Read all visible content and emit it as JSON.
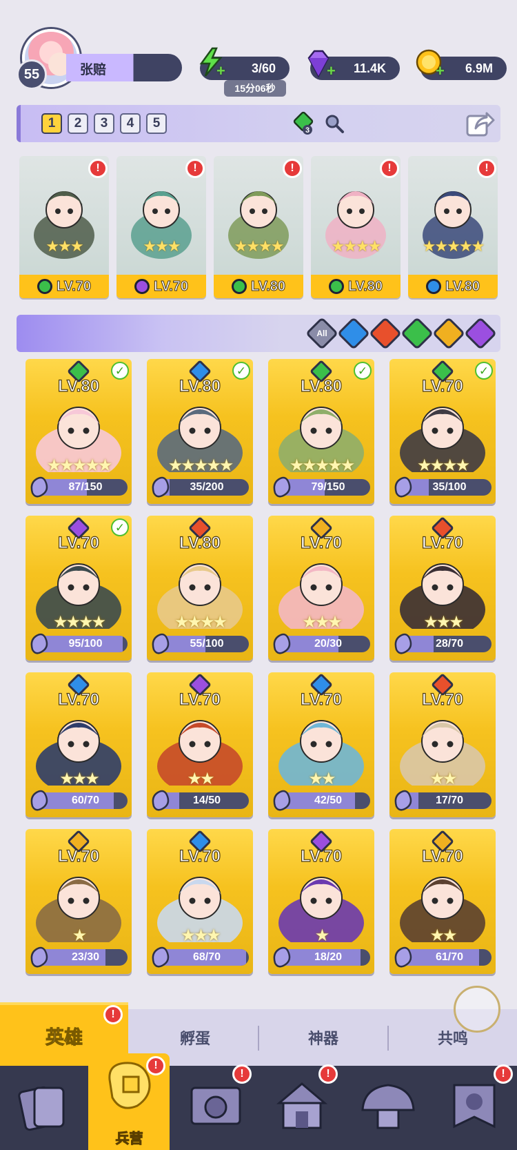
{
  "player": {
    "level": "55",
    "name": "张赔"
  },
  "resources": {
    "energy": {
      "icon": "lightning-icon",
      "value": "3/60",
      "timer": "15分06秒"
    },
    "gems": {
      "icon": "purple-gem-icon",
      "value": "11.4K"
    },
    "gold": {
      "icon": "gold-coin-icon",
      "value": "6.9M"
    }
  },
  "team_tabs": [
    "1",
    "2",
    "3",
    "4",
    "5"
  ],
  "team_active_tab": "1",
  "team_gem_badge": "3",
  "team": [
    {
      "level": "LV.70",
      "element": "green",
      "stars": 3,
      "alert": "!",
      "art": "#4f5d4a"
    },
    {
      "level": "LV.70",
      "element": "purple",
      "stars": 3,
      "alert": "!",
      "art": "#5aa08f"
    },
    {
      "level": "LV.80",
      "element": "green",
      "stars": 4,
      "alert": "!",
      "art": "#7f9b5a"
    },
    {
      "level": "LV.80",
      "element": "green",
      "stars": 4,
      "alert": "!",
      "art": "#f0b2c4"
    },
    {
      "level": "LV.80",
      "element": "blue",
      "stars": 5,
      "alert": "!",
      "art": "#3b4a7a"
    }
  ],
  "filters": [
    {
      "label": "All",
      "color": "#8a8ca8"
    },
    {
      "label": "",
      "color": "#2f8ee8"
    },
    {
      "label": "",
      "color": "#e8502c"
    },
    {
      "label": "",
      "color": "#3bbf4a"
    },
    {
      "label": "",
      "color": "#f0b020"
    },
    {
      "label": "",
      "color": "#9b4fe0"
    }
  ],
  "element_colors": {
    "green": "#3bbf4a",
    "purple": "#9b4fe0",
    "blue": "#2f8ee8",
    "red": "#e8502c",
    "gold": "#f0b020"
  },
  "heroes": [
    {
      "level": "LV.80",
      "element": "green",
      "check": true,
      "stars": 5,
      "fragments": "87/150",
      "progress": 0.58,
      "art": "#f7c8d8"
    },
    {
      "level": "LV.80",
      "element": "blue",
      "check": true,
      "stars": 5,
      "fragments": "35/200",
      "progress": 0.18,
      "art": "#5a6a7d"
    },
    {
      "level": "LV.80",
      "element": "green",
      "check": true,
      "stars": 5,
      "fragments": "79/150",
      "progress": 0.53,
      "art": "#8fae6a"
    },
    {
      "level": "LV.70",
      "element": "green",
      "check": true,
      "stars": 4,
      "fragments": "35/100",
      "progress": 0.35,
      "art": "#3f3b44"
    },
    {
      "level": "LV.70",
      "element": "purple",
      "check": true,
      "stars": 4,
      "fragments": "95/100",
      "progress": 0.95,
      "art": "#3b4a4e"
    },
    {
      "level": "LV.80",
      "element": "red",
      "check": false,
      "stars": 4,
      "fragments": "55/100",
      "progress": 0.55,
      "art": "#e8c98a"
    },
    {
      "level": "LV.70",
      "element": "gold",
      "check": false,
      "stars": 3,
      "fragments": "20/30",
      "progress": 0.67,
      "art": "#f3b7c4"
    },
    {
      "level": "LV.70",
      "element": "red",
      "check": false,
      "stars": 3,
      "fragments": "28/70",
      "progress": 0.4,
      "art": "#3a2f35"
    },
    {
      "level": "LV.70",
      "element": "blue",
      "check": false,
      "stars": 3,
      "fragments": "60/70",
      "progress": 0.86,
      "art": "#2e3d6a"
    },
    {
      "level": "LV.70",
      "element": "purple",
      "check": false,
      "stars": 2,
      "fragments": "14/50",
      "progress": 0.28,
      "art": "#c64a2a"
    },
    {
      "level": "LV.70",
      "element": "blue",
      "check": false,
      "stars": 2,
      "fragments": "42/50",
      "progress": 0.84,
      "art": "#6fb6d6"
    },
    {
      "level": "LV.70",
      "element": "red",
      "check": false,
      "stars": 2,
      "fragments": "17/70",
      "progress": 0.24,
      "art": "#d9c7a8"
    },
    {
      "level": "LV.70",
      "element": "gold",
      "check": false,
      "stars": 1,
      "fragments": "23/30",
      "progress": 0.77,
      "art": "#8a6b44"
    },
    {
      "level": "LV.70",
      "element": "blue",
      "check": false,
      "stars": 3,
      "fragments": "68/70",
      "progress": 0.97,
      "art": "#c9d8ee"
    },
    {
      "level": "LV.70",
      "element": "purple",
      "check": false,
      "stars": 1,
      "fragments": "18/20",
      "progress": 0.9,
      "art": "#6a3ab0"
    },
    {
      "level": "LV.70",
      "element": "gold",
      "check": false,
      "stars": 2,
      "fragments": "61/70",
      "progress": 0.87,
      "art": "#5b4030"
    }
  ],
  "subtabs": [
    "英雄",
    "孵蛋",
    "神器",
    "共鸣"
  ],
  "subtab_alert": "!",
  "bottom_nav": [
    {
      "icon": "cards-icon",
      "label": "",
      "alert": false
    },
    {
      "icon": "barracks-icon",
      "label": "兵营",
      "alert": true
    },
    {
      "icon": "book-icon",
      "label": "",
      "alert": true
    },
    {
      "icon": "temple-icon",
      "label": "",
      "alert": true
    },
    {
      "icon": "guild-icon",
      "label": "",
      "alert": false
    },
    {
      "icon": "banner-icon",
      "label": "",
      "alert": true
    }
  ],
  "nav_alert": "!"
}
